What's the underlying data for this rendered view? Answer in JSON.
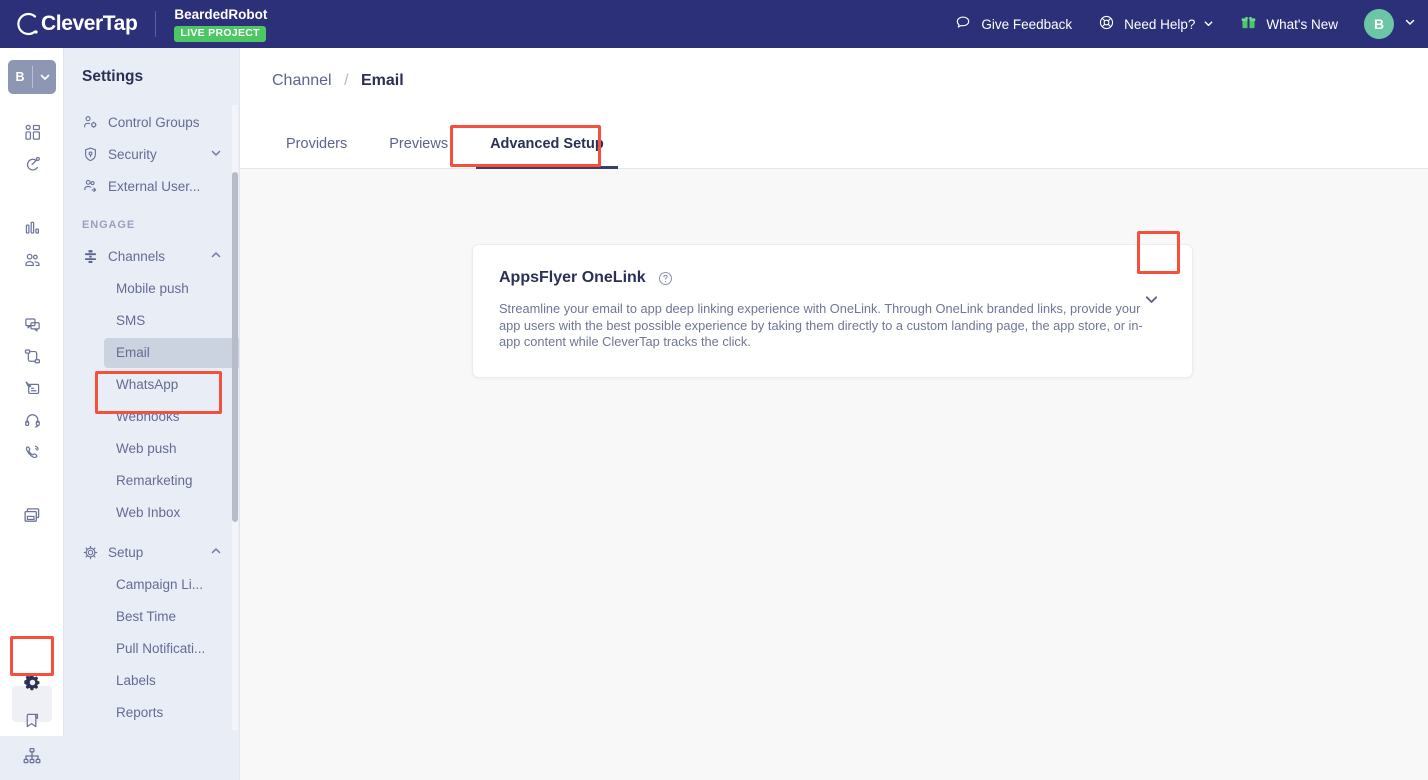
{
  "topbar": {
    "logo_text": "CleverTap",
    "logo_icon": "clevertap-logo-icon",
    "project_name": "BeardedRobot",
    "project_status_badge": "LIVE PROJECT",
    "items": [
      {
        "label": "Give Feedback",
        "icon": "chat-bubble-icon",
        "has_chevron": false
      },
      {
        "label": "Need Help?",
        "icon": "lifebuoy-icon",
        "has_chevron": true
      },
      {
        "label": "What's New",
        "icon": "gift-icon",
        "has_chevron": false
      }
    ],
    "avatar_letter": "B",
    "brand_color": "#2b3079",
    "badge_color": "#4cc764",
    "avatar_color": "#6cc5a5"
  },
  "rail": {
    "switcher_letter": "B",
    "icons": [
      {
        "name": "dashboard-icon"
      },
      {
        "name": "campaigns-icon"
      },
      {
        "name": "analytics-icon"
      },
      {
        "name": "segments-icon"
      },
      {
        "name": "messages-icon"
      },
      {
        "name": "journeys-icon"
      },
      {
        "name": "signed-content-icon"
      },
      {
        "name": "support-headset-icon"
      },
      {
        "name": "phone-call-icon"
      },
      {
        "name": "inbox-cards-icon"
      },
      {
        "name": "settings-gear-icon"
      },
      {
        "name": "bookmark-icon"
      },
      {
        "name": "alerts-warning-icon"
      },
      {
        "name": "sitemap-icon"
      }
    ],
    "active_icon": "settings-gear-icon"
  },
  "sidebar": {
    "title": "Settings",
    "top_items": [
      {
        "label": "Control Groups",
        "icon": "user-settings-icon",
        "chevron": "none"
      },
      {
        "label": "Security",
        "icon": "shield-lock-icon",
        "chevron": "down"
      },
      {
        "label": "External User...",
        "icon": "external-users-icon",
        "chevron": "none"
      }
    ],
    "sections": [
      {
        "heading": "ENGAGE",
        "groups": [
          {
            "label": "Channels",
            "icon": "broadcast-icon",
            "chevron": "up",
            "items": [
              "Mobile push",
              "SMS",
              "Email",
              "WhatsApp",
              "Webhooks",
              "Web push",
              "Remarketing",
              "Web Inbox"
            ]
          },
          {
            "label": "Setup",
            "icon": "gear-icon",
            "chevron": "up",
            "items": [
              "Campaign Li...",
              "Best Time",
              "Pull Notificati...",
              "Labels",
              "Reports"
            ]
          }
        ]
      }
    ],
    "selected_item": "Email"
  },
  "main": {
    "breadcrumb": {
      "parent": "Channel",
      "separator": "/",
      "current": "Email"
    },
    "tabs": [
      {
        "label": "Providers",
        "active": false
      },
      {
        "label": "Previews",
        "active": false
      },
      {
        "label": "Advanced Setup",
        "active": true
      }
    ],
    "card": {
      "title": "AppsFlyer OneLink",
      "help_icon": "question-circle-icon",
      "description": "Streamline your email to app deep linking experience with OneLink. Through OneLink branded links, provide your app users with the best possible experience by taking them directly to a custom landing page, the app store, or in-app content while CleverTap tracks the click.",
      "toggle_icon": "chevron-down-icon"
    }
  },
  "annotations": {
    "color": "#f4503c",
    "boxes": [
      {
        "name": "annotation-settings-rail-icon"
      },
      {
        "name": "annotation-sidebar-email-item"
      },
      {
        "name": "annotation-advanced-setup-tab"
      },
      {
        "name": "annotation-card-expand-chevron"
      }
    ]
  }
}
